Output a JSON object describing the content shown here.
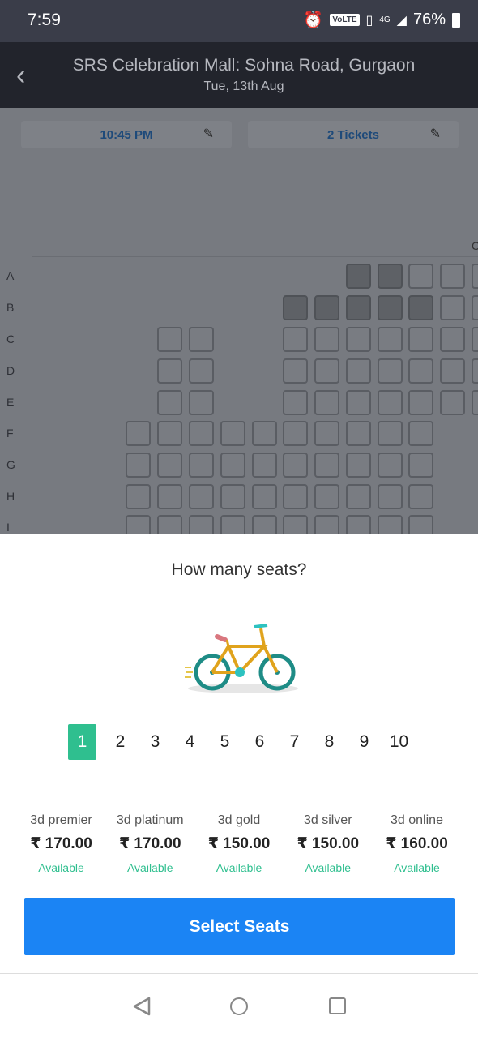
{
  "status": {
    "time": "7:59",
    "volte": "VoLTE",
    "network": "4G",
    "battery": "76%"
  },
  "header": {
    "venue": "SRS Celebration Mall: Sohna Road, Gurgaon",
    "date": "Tue, 13th Aug"
  },
  "selectors": {
    "time_label": "10:45 PM",
    "tickets_label": "2 Tickets"
  },
  "seat_map": {
    "column_header": "C",
    "rows": [
      "A",
      "B",
      "C",
      "D",
      "E",
      "F",
      "G",
      "H",
      "I"
    ]
  },
  "sheet": {
    "question": "How many seats?",
    "counts": [
      "1",
      "2",
      "3",
      "4",
      "5",
      "6",
      "7",
      "8",
      "9",
      "10"
    ],
    "selected_count": "1",
    "categories": [
      {
        "name": "3d premier",
        "price": "₹ 170.00",
        "status": "Available"
      },
      {
        "name": "3d platinum",
        "price": "₹ 170.00",
        "status": "Available"
      },
      {
        "name": "3d gold",
        "price": "₹ 150.00",
        "status": "Available"
      },
      {
        "name": "3d silver",
        "price": "₹ 150.00",
        "status": "Available"
      },
      {
        "name": "3d online",
        "price": "₹ 160.00",
        "status": "Available"
      }
    ],
    "button_label": "Select Seats"
  },
  "colors": {
    "accent": "#1b84f4",
    "selected": "#2fbf8f",
    "header_bg": "#22242c"
  }
}
